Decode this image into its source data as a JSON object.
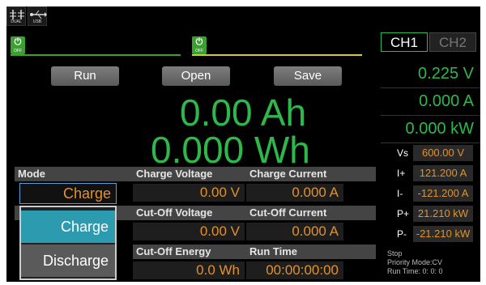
{
  "status_icons": {
    "dual_label": "DUAL",
    "usb_label": "USB"
  },
  "channels": {
    "power_off_label": "OFF",
    "tabs": [
      "CH1",
      "CH2"
    ],
    "ch1_color": "#3aa030",
    "ch2_color": "#d8cc20"
  },
  "actions": {
    "run": "Run",
    "open": "Open",
    "save": "Save"
  },
  "readouts": {
    "capacity": "0.00 Ah",
    "energy": "0.000 Wh"
  },
  "measurements": {
    "voltage": "0.225 V",
    "current": "0.000 A",
    "power": "0.000 kW"
  },
  "params": [
    {
      "label": "Vs",
      "value": "600.00 V"
    },
    {
      "label": "I+",
      "value": "121.200 A"
    },
    {
      "label": "I-",
      "value": "-121.200 A"
    },
    {
      "label": "P+",
      "value": "21.210 kW"
    },
    {
      "label": "P-",
      "value": "-21.210 kW"
    }
  ],
  "status": {
    "state": "Stop",
    "priority": "Priority Mode:CV",
    "run_time": "Run Time: 0: 0: 0"
  },
  "settings": {
    "mode_label": "Mode",
    "mode_value": "Charge",
    "mode_options": [
      "Charge",
      "Discharge"
    ],
    "charge_voltage_label": "Charge Voltage",
    "charge_voltage_value": "0.00 V",
    "charge_current_label": "Charge Current",
    "charge_current_value": "0.000 A",
    "cutoff_voltage_label": "Cut-Off Voltage",
    "cutoff_voltage_value": "0.00 V",
    "cutoff_current_label": "Cut-Off Current",
    "cutoff_current_value": "0.000 A",
    "cutoff_energy_label": "Cut-Off Energy",
    "cutoff_energy_value": "0.0 Wh",
    "run_time_label": "Run Time",
    "run_time_value": "00:00:00:00"
  },
  "colors": {
    "accent_green": "#2fb84a",
    "value_orange": "#e0922d",
    "selected_teal": "#2c9bb0"
  }
}
